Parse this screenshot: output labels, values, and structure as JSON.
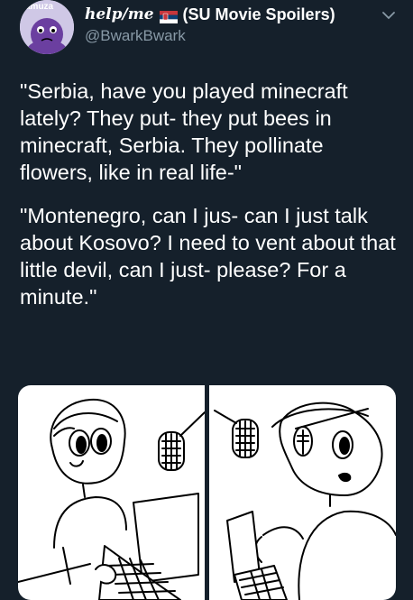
{
  "tweet": {
    "display_name_handwritten": "help/me",
    "display_name_suffix": "(SU Movie Spoilers)",
    "handle": "@BwarkBwark",
    "avatar_label": "amuza",
    "paragraphs": [
      "\"Serbia, have you played minecraft lately? They put- they put bees in minecraft, Serbia. They pollinate flowers, like in real life-\"",
      "\"Montenegro, can I jus- can I just talk about Kosovo? I need to vent about that little devil, can I just- please? For a minute.\""
    ]
  },
  "icons": {
    "avatar": "avatar-cartoon-icon",
    "flag": "serbia-flag-icon",
    "caret": "chevron-down-icon"
  },
  "colors": {
    "background": "#15202b",
    "text_primary": "#ffffff",
    "text_secondary": "#8899a6",
    "avatar_purple": "#6b3fa0"
  }
}
